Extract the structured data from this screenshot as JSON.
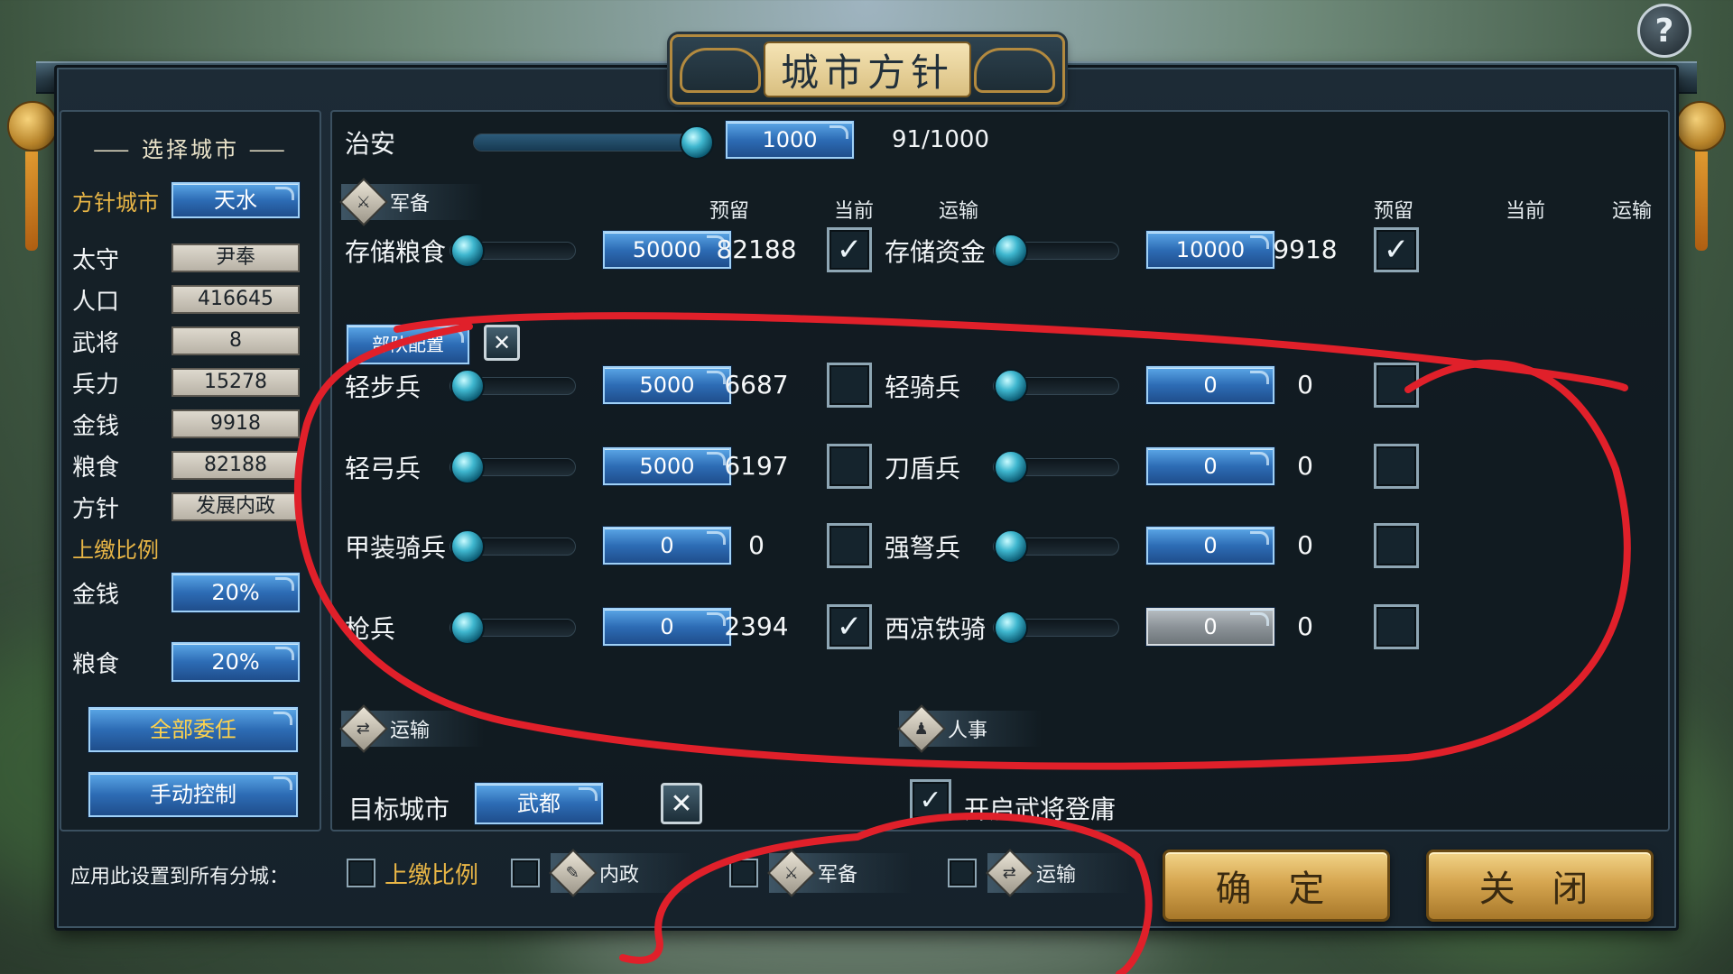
{
  "title": "城市方针",
  "help_label": "?",
  "left_panel": {
    "select_city_title": "选择城市",
    "policy_city_label": "方针城市",
    "policy_city_value": "天水",
    "stats": [
      {
        "label": "太守",
        "value": "尹奉"
      },
      {
        "label": "人口",
        "value": "416645"
      },
      {
        "label": "武将",
        "value": "8"
      },
      {
        "label": "兵力",
        "value": "15278"
      },
      {
        "label": "金钱",
        "value": "9918"
      },
      {
        "label": "粮食",
        "value": "82188"
      },
      {
        "label": "方针",
        "value": "发展内政"
      }
    ],
    "tax_ratio_label": "上缴比例",
    "tax_rows": [
      {
        "label": "金钱",
        "value": "20%"
      },
      {
        "label": "粮食",
        "value": "20%"
      }
    ],
    "delegate_all_label": "全部委任",
    "manual_control_label": "手动控制"
  },
  "security": {
    "label": "治安",
    "value": "1000",
    "current": "91/1000",
    "slider_fraction": 1.0
  },
  "military": {
    "section_label": "军备",
    "col_reserve": "预留",
    "col_current": "当前",
    "col_transport": "运输",
    "storage": [
      {
        "label": "存储粮食",
        "reserve": "50000",
        "current": "82188",
        "checked": true,
        "slider_fraction": 0.0
      },
      {
        "label": "存储资金",
        "reserve": "10000",
        "current": "9918",
        "checked": true,
        "slider_fraction": 0.0
      }
    ],
    "troop_config_label": "部队配置",
    "troops_left": [
      {
        "label": "轻步兵",
        "reserve": "5000",
        "current": "6687",
        "checked": false
      },
      {
        "label": "轻弓兵",
        "reserve": "5000",
        "current": "6197",
        "checked": false
      },
      {
        "label": "甲装骑兵",
        "reserve": "0",
        "current": "0",
        "checked": false
      },
      {
        "label": "枪兵",
        "reserve": "0",
        "current": "2394",
        "checked": true
      }
    ],
    "troops_right": [
      {
        "label": "轻骑兵",
        "reserve": "0",
        "current": "0",
        "checked": false,
        "disabled": false
      },
      {
        "label": "刀盾兵",
        "reserve": "0",
        "current": "0",
        "checked": false,
        "disabled": false
      },
      {
        "label": "强弩兵",
        "reserve": "0",
        "current": "0",
        "checked": false,
        "disabled": false
      },
      {
        "label": "西凉铁骑",
        "reserve": "0",
        "current": "0",
        "checked": false,
        "disabled": true
      }
    ]
  },
  "transport": {
    "section_label": "运输",
    "target_city_label": "目标城市",
    "target_city_value": "武都"
  },
  "personnel": {
    "section_label": "人事",
    "enable_recruit_label": "开启武将登庸"
  },
  "bottom": {
    "apply_all_label": "应用此设置到所有分城：",
    "opt_tax": "上缴比例",
    "opt_domestic": "内政",
    "opt_military": "军备",
    "opt_transport": "运输",
    "confirm_label": "确 定",
    "close_label": "关 闭"
  },
  "colors": {
    "accent_blue": "#2d6cb5",
    "gold": "#e9b646",
    "annotation_red": "#e0202a"
  }
}
